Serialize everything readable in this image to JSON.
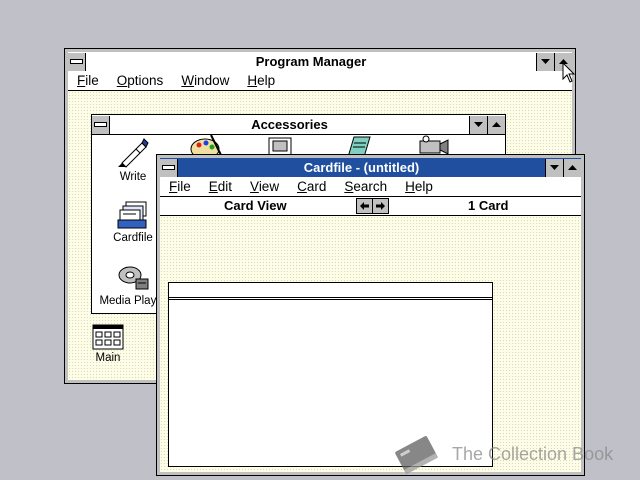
{
  "program_manager": {
    "title": "Program Manager",
    "menu": [
      "File",
      "Options",
      "Window",
      "Help"
    ]
  },
  "accessories": {
    "title": "Accessories",
    "icons": [
      {
        "label": "Write",
        "icon": "write-pen-icon"
      },
      {
        "label": "Cardfile",
        "icon": "cardfile-icon"
      },
      {
        "label": "Media Player",
        "icon": "media-player-icon"
      }
    ]
  },
  "main_group": {
    "label": "Main",
    "icon": "program-group-icon"
  },
  "cardfile": {
    "title": "Cardfile - (untitled)",
    "menu": [
      "File",
      "Edit",
      "View",
      "Card",
      "Search",
      "Help"
    ],
    "view_label": "Card View",
    "card_count": "1 Card"
  },
  "watermark": {
    "text": "The Collection Book"
  },
  "colors": {
    "active_title": "#1f4f9e",
    "workspace": "#fefde6",
    "desktop": "#c0c0c8"
  }
}
